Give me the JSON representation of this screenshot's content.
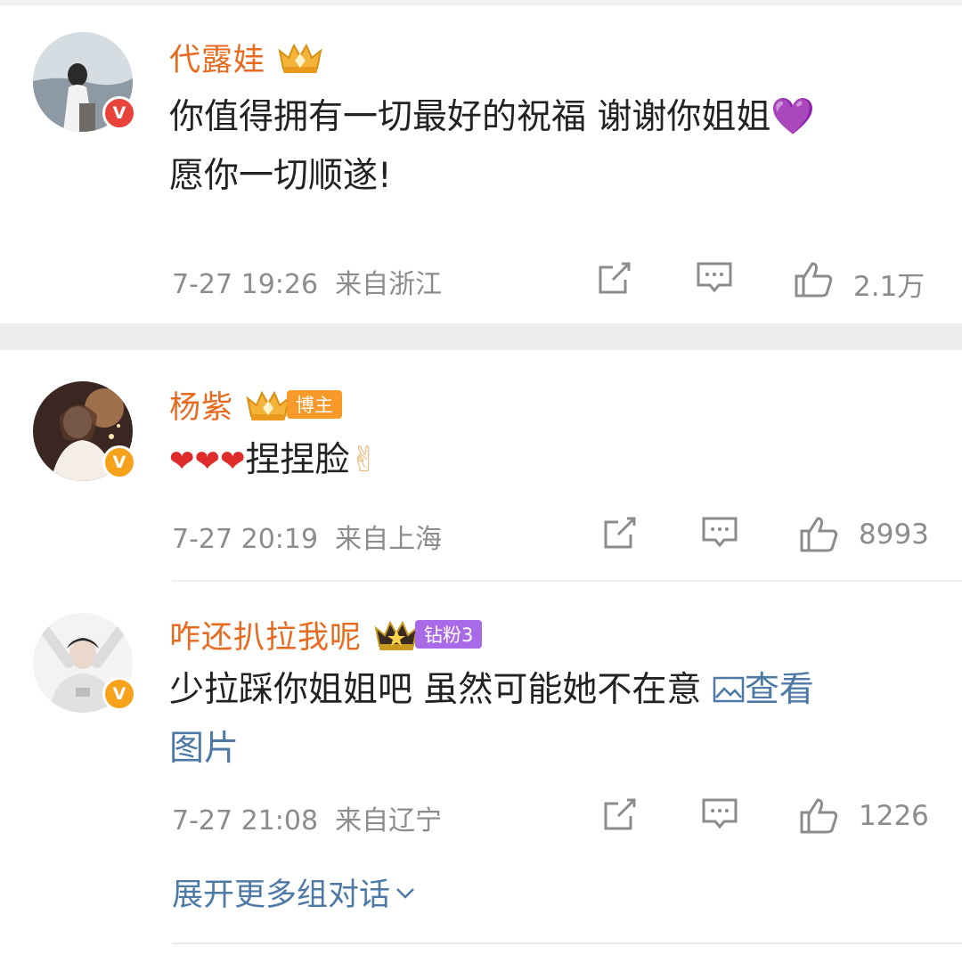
{
  "comments": [
    {
      "username": "代露娃",
      "badge_tag": "",
      "text_line1": "你值得拥有一切最好的祝福 谢谢你姐姐",
      "text_emoji": "💜",
      "text_line2": "愿你一切顺遂!",
      "date": "7-27 19:26",
      "location": "来自浙江",
      "likes": "2.1万"
    },
    {
      "username": "杨紫",
      "badge_tag": "博主",
      "text_emoji_prefix": "❤❤❤",
      "text_line1": "捏捏脸",
      "text_emoji": "✌",
      "date": "7-27 20:19",
      "location": "来自上海",
      "likes": "8993"
    },
    {
      "username": "咋还扒拉我呢",
      "badge_tag": "钻粉3",
      "text_line1": "少拉踩你姐姐吧 虽然可能她不在意",
      "link_text_a": "查看",
      "link_text_b": "图片",
      "date": "7-27 21:08",
      "location": "来自辽宁",
      "likes": "1226"
    }
  ],
  "expand_label": "展开更多组对话",
  "icons": {
    "share": "share-icon",
    "comment": "comment-icon",
    "like": "thumbs-up-icon",
    "verified": "verified-v-icon",
    "crown": "crown-icon",
    "image": "image-icon",
    "chevron": "chevron-down-icon"
  },
  "colors": {
    "username": "#e86a1f",
    "link": "#4d79a6",
    "meta": "#8c8c8c",
    "blogger_tag": "#f89a2a",
    "fan_tag": "#a86ae6"
  }
}
